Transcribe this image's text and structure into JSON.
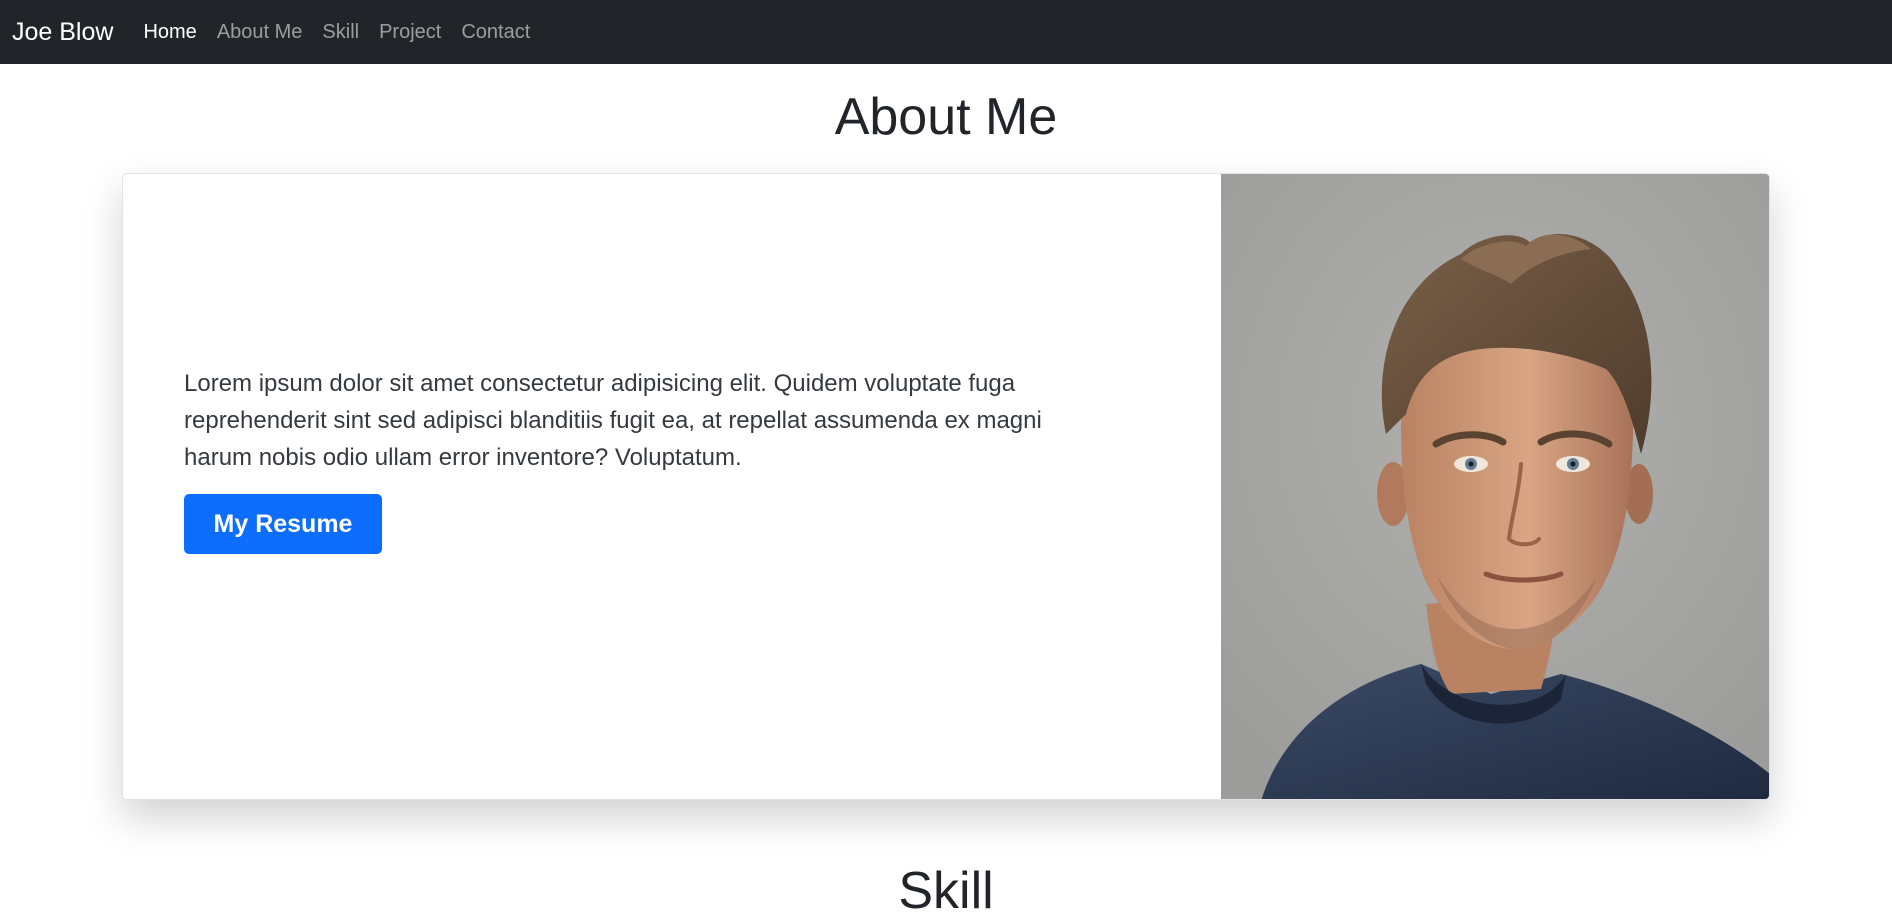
{
  "navbar": {
    "brand": "Joe Blow",
    "links": [
      {
        "label": "Home",
        "active": true
      },
      {
        "label": "About Me",
        "active": false
      },
      {
        "label": "Skill",
        "active": false
      },
      {
        "label": "Project",
        "active": false
      },
      {
        "label": "Contact",
        "active": false
      }
    ]
  },
  "about": {
    "title": "About Me",
    "text": "Lorem ipsum dolor sit amet consectetur adipisicing elit. Quidem voluptate fuga reprehenderit sint sed adipisci blanditiis fugit ea, at repellat assumenda ex magni harum nobis odio ullam error inventore? Voluptatum.",
    "button_label": "My Resume"
  },
  "next_section": {
    "title": "Skill"
  },
  "colors": {
    "navbar_bg": "#212529",
    "primary": "#0d6efd",
    "photo_bg": "#a6a6a4"
  }
}
